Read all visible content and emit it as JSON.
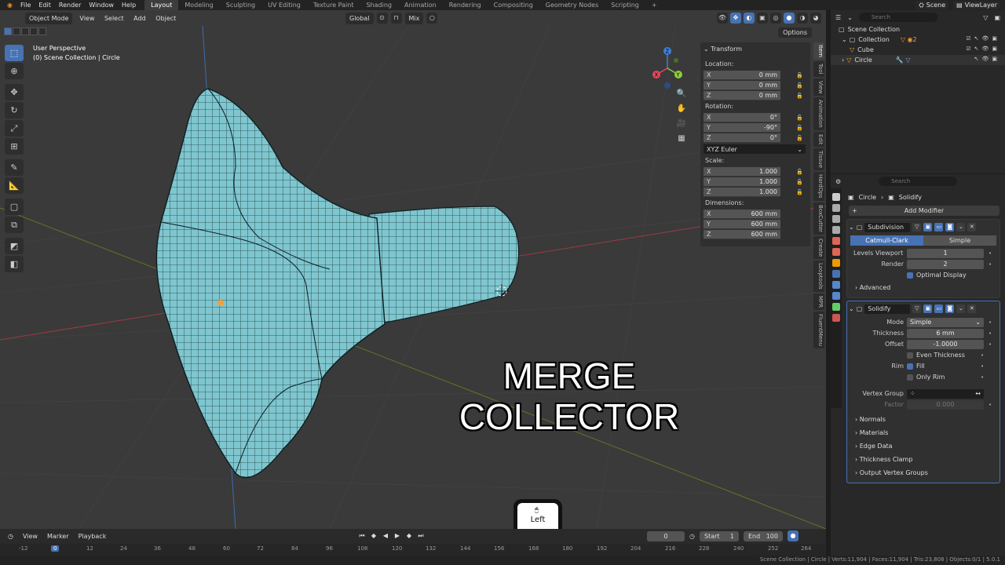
{
  "menubar": {
    "items": [
      "File",
      "Edit",
      "Render",
      "Window",
      "Help"
    ],
    "workspaces": [
      "Layout",
      "Modeling",
      "Sculpting",
      "UV Editing",
      "Texture Paint",
      "Shading",
      "Animation",
      "Rendering",
      "Compositing",
      "Geometry Nodes",
      "Scripting"
    ],
    "active_workspace": "Layout",
    "add_tab": "+",
    "scene": "Scene",
    "view_layer": "ViewLayer"
  },
  "viewport": {
    "mode": "Object Mode",
    "menu": [
      "View",
      "Select",
      "Add",
      "Object"
    ],
    "orientation": "Global",
    "snap_label": "Mix",
    "options": "Options",
    "perspective": "User Perspective",
    "collection_info": "(0) Scene Collection | Circle",
    "gizmo_axes": {
      "x": "X",
      "y": "Y",
      "z": "Z"
    }
  },
  "npanel": {
    "header": "Transform",
    "location_label": "Location:",
    "location": [
      {
        "axis": "X",
        "value": "0 mm"
      },
      {
        "axis": "Y",
        "value": "0 mm"
      },
      {
        "axis": "Z",
        "value": "0 mm"
      }
    ],
    "rotation_label": "Rotation:",
    "rotation": [
      {
        "axis": "X",
        "value": "0°"
      },
      {
        "axis": "Y",
        "value": "-90°"
      },
      {
        "axis": "Z",
        "value": "0°"
      }
    ],
    "rotation_mode": "XYZ Euler",
    "scale_label": "Scale:",
    "scale": [
      {
        "axis": "X",
        "value": "1.000"
      },
      {
        "axis": "Y",
        "value": "1.000"
      },
      {
        "axis": "Z",
        "value": "1.000"
      }
    ],
    "dimensions_label": "Dimensions:",
    "dimensions": [
      {
        "axis": "X",
        "value": "600 mm"
      },
      {
        "axis": "Y",
        "value": "600 mm"
      },
      {
        "axis": "Z",
        "value": "600 mm"
      }
    ],
    "tabs": [
      "Item",
      "Tool",
      "View",
      "Animation",
      "Edit",
      "Tissue",
      "HardOps",
      "BoxCutter",
      "Create",
      "Looptools",
      "MPR",
      "FluentMenu"
    ]
  },
  "overlay": {
    "line1": "MERGE",
    "line2": "COLLECTOR"
  },
  "mouse_hint": {
    "label": "Left"
  },
  "timeline": {
    "menu": [
      "View",
      "Marker",
      "Playback"
    ],
    "current_frame": "0",
    "start_label": "Start",
    "start": "1",
    "end_label": "End",
    "end": "100",
    "ruler": [
      "-12",
      "0",
      "12",
      "24",
      "36",
      "48",
      "60",
      "72",
      "84",
      "96",
      "108",
      "120",
      "132",
      "144",
      "156",
      "168",
      "180",
      "192",
      "204",
      "216",
      "228",
      "240",
      "252",
      "264"
    ]
  },
  "statusbar": {
    "text": "Scene Collection | Circle | Verts:11,904 | Faces:11,904 | Tris:23,808 | Objects:0/1 | 5.0.1"
  },
  "outliner": {
    "search_placeholder": "Search",
    "root": "Scene Collection",
    "rows": [
      {
        "name": "Collection",
        "indent": 1
      },
      {
        "name": "Cube",
        "indent": 2
      },
      {
        "name": "Circle",
        "indent": 1
      }
    ]
  },
  "properties": {
    "search_placeholder": "Search",
    "object": "Circle",
    "modifier_context": "Solidify",
    "add_modifier": "Add Modifier",
    "subdivision": {
      "name": "Subdivision",
      "methods": [
        "Catmull-Clark",
        "Simple"
      ],
      "active_method": "Catmull-Clark",
      "levels_viewport_label": "Levels Viewport",
      "levels_viewport": "1",
      "render_label": "Render",
      "render": "2",
      "optimal_display": "Optimal Display",
      "advanced": "Advanced"
    },
    "solidify": {
      "name": "Solidify",
      "mode_label": "Mode",
      "mode": "Simple",
      "thickness_label": "Thickness",
      "thickness": "6 mm",
      "offset_label": "Offset",
      "offset": "-1.0000",
      "even_thickness": "Even Thickness",
      "rim_label": "Rim",
      "fill": "Fill",
      "only_rim": "Only Rim",
      "vertex_group_label": "Vertex Group",
      "factor_label": "Factor",
      "factor": "0.000",
      "subpanels": [
        "Normals",
        "Materials",
        "Edge Data",
        "Thickness Clamp",
        "Output Vertex Groups"
      ]
    }
  },
  "colors": {
    "accent": "#4772b3",
    "mesh": "#7fc6cf",
    "x_axis": "#e04a5a",
    "y_axis": "#8ecf3a",
    "z_axis": "#3d7fe0"
  }
}
